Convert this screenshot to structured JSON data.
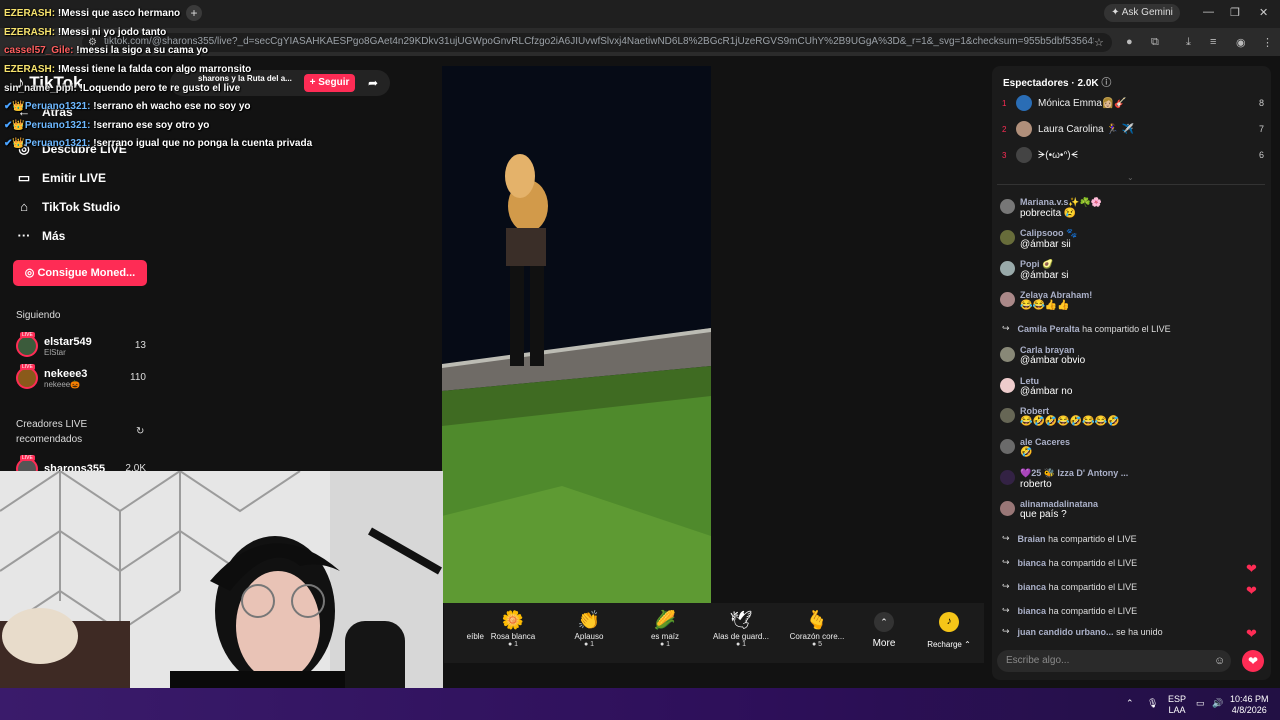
{
  "browser": {
    "tab_title": "sharons y la Ruta del a...",
    "url": "tiktok.com/@sharons355/live?_d=secCgYIASAHKAESPgo8GAet4n29KDkv31ujUGWpoGnvRLCfzgo2iA6JIUvwfSlvxj4NaetiwND6L8%2BGcR1jUzeRGVS9mCUhY%2B9UGgA%3D&_r=1&_svg=1&checksum=955b5dbf53564f99380fe455db8e77...",
    "ask_gemini": "Ask Gemini",
    "new_tab": "+"
  },
  "sidebar": {
    "logo": "TikTok",
    "back": "Atrás",
    "items": [
      {
        "label": "Descubre LIVE",
        "icon": "live-icon"
      },
      {
        "label": "Emitir LIVE",
        "icon": "camera-icon"
      },
      {
        "label": "TikTok Studio",
        "icon": "home-icon"
      },
      {
        "label": "Más",
        "icon": "more-icon"
      }
    ],
    "coins_button": "Consigue Moned...",
    "following_title": "Siguiendo",
    "following": [
      {
        "name": "elstar549",
        "sub": "ElStar",
        "count": "13"
      },
      {
        "name": "nekeee3",
        "sub": "nekeee🎃",
        "count": "110"
      }
    ],
    "recommended_title": "Creadores LIVE recomendados",
    "recommended": [
      {
        "name": "sharons355",
        "count": "2.0K"
      }
    ]
  },
  "stream": {
    "title": "sharons y la Ruta del a...",
    "follow": "+ Seguir"
  },
  "overlay_chat": [
    {
      "user": "EZERASH:",
      "text": "!Messi que asco hermano"
    },
    {
      "user": "EZERASH:",
      "text": "!Messi ni yo jodo tanto"
    },
    {
      "user": "cassel57_Gile:",
      "text": "!messi la sigo a su cama yo"
    },
    {
      "user": "EZERASH:",
      "text": "!Messi tiene la falda con algo marronsito"
    },
    {
      "user": "sin_name_pipi:",
      "text": "!Loquendo pero te re gusto el live"
    },
    {
      "user": "Peruano1321:",
      "text": "!serrano eh wacho ese no soy yo"
    },
    {
      "user": "Peruano1321:",
      "text": "!serrano ese soy otro yo"
    },
    {
      "user": "Peruano1321:",
      "text": "!serrano igual que no ponga la cuenta privada"
    }
  ],
  "gifts": [
    {
      "name": "eíble",
      "price": "",
      "icon": "gift-icon"
    },
    {
      "name": "Rosa blanca",
      "price": "1",
      "icon": "rose-icon"
    },
    {
      "name": "Aplauso",
      "price": "1",
      "icon": "clap-icon"
    },
    {
      "name": "es maíz",
      "price": "1",
      "icon": "corn-icon"
    },
    {
      "name": "Alas de guard...",
      "price": "1",
      "icon": "wings-icon"
    },
    {
      "name": "Corazón core...",
      "price": "5",
      "icon": "heart-hand-icon"
    }
  ],
  "gift_more": "More",
  "recharge": "Recharge",
  "panel": {
    "viewers_title": "Espectadores · 2.0K",
    "top_viewers": [
      {
        "rank": "1",
        "name": "Mónica Emma👩🏼🎸",
        "score": "8"
      },
      {
        "rank": "2",
        "name": "Laura Carolina 🏃‍♀️ ✈️",
        "score": "7"
      },
      {
        "rank": "3",
        "name": "ᗒ(•ω•ᐢ)ᗕ",
        "score": "6"
      }
    ],
    "messages": [
      {
        "user": "Mariana.v.s✨☘️🌸",
        "text": "pobrecita 😢"
      },
      {
        "user": "Calipsooo 🐾",
        "text": "@ámbar sii"
      },
      {
        "user": "Popi 🥑",
        "text": "@ámbar si"
      },
      {
        "user": "Zelaya Abraham!",
        "text": "😂😂👍👍"
      },
      {
        "user": "Camila Peralta",
        "text": "ha compartido el LIVE",
        "share": true
      },
      {
        "user": "Carla brayan",
        "text": "@ámbar obvio"
      },
      {
        "user": "Letu",
        "text": "@ámbar no"
      },
      {
        "user": "Robert",
        "text": "😂🤣🤣😂🤣😂😂🤣"
      },
      {
        "user": "ale Caceres",
        "text": "🤣"
      },
      {
        "user": "💜25 🐝 Izza D' Antony ...",
        "text": "roberto"
      },
      {
        "user": "alinamadalinatana",
        "text": "que país ?"
      }
    ],
    "shares": [
      {
        "user": "Braian",
        "text": "ha compartido el LIVE"
      },
      {
        "user": "bianca",
        "text": "ha compartido el LIVE"
      },
      {
        "user": "bianca",
        "text": "ha compartido el LIVE"
      },
      {
        "user": "bianca",
        "text": "ha compartido el LIVE"
      },
      {
        "user": "juan candido urbano...",
        "text": "se ha unido"
      }
    ],
    "input_placeholder": "Escribe algo..."
  },
  "taskbar": {
    "lang": "ESP",
    "lang2": "LAA",
    "time": "10:46 PM",
    "date": "4/8/2026"
  }
}
